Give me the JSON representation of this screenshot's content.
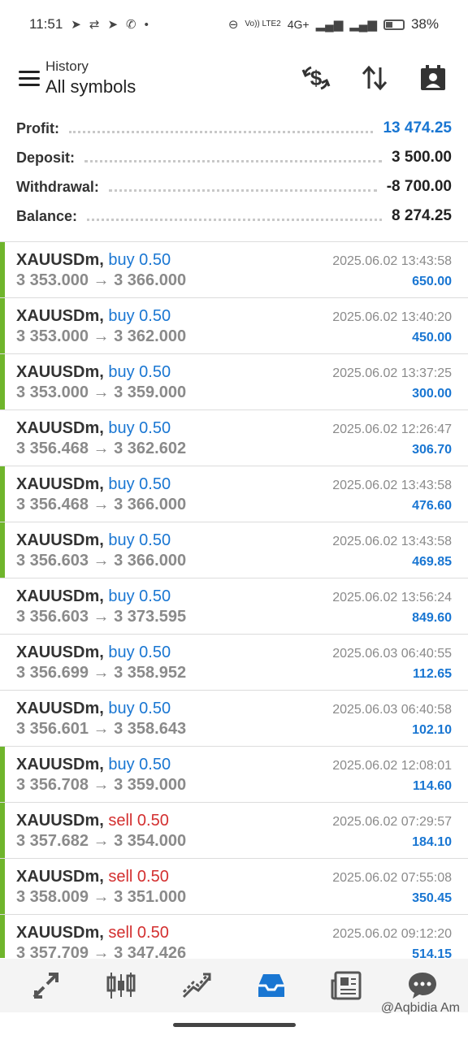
{
  "status_bar": {
    "time": "11:51",
    "network": "4G+",
    "volte": "Vo)) LTE2",
    "battery": "38%",
    "battery_level": 0.38
  },
  "header": {
    "subtitle": "History",
    "title": "All symbols",
    "icons": [
      "currency-exchange-icon",
      "sort-icon",
      "calendar-person-icon"
    ]
  },
  "summary": {
    "profit_label": "Profit:",
    "profit_value": "13 474.25",
    "deposit_label": "Deposit:",
    "deposit_value": "3 500.00",
    "withdrawal_label": "Withdrawal:",
    "withdrawal_value": "-8 700.00",
    "balance_label": "Balance:",
    "balance_value": "8 274.25"
  },
  "trades": [
    {
      "symbol": "XAUUSDm,",
      "direction": "buy 0.50",
      "type": "buy",
      "prices": "3 353.000 → 3 366.000",
      "time": "2025.06.02 13:43:58",
      "profit": "650.00",
      "marked": true
    },
    {
      "symbol": "XAUUSDm,",
      "direction": "buy 0.50",
      "type": "buy",
      "prices": "3 353.000 → 3 362.000",
      "time": "2025.06.02 13:40:20",
      "profit": "450.00",
      "marked": true
    },
    {
      "symbol": "XAUUSDm,",
      "direction": "buy 0.50",
      "type": "buy",
      "prices": "3 353.000 → 3 359.000",
      "time": "2025.06.02 13:37:25",
      "profit": "300.00",
      "marked": true
    },
    {
      "symbol": "XAUUSDm,",
      "direction": "buy 0.50",
      "type": "buy",
      "prices": "3 356.468 → 3 362.602",
      "time": "2025.06.02 12:26:47",
      "profit": "306.70",
      "marked": false
    },
    {
      "symbol": "XAUUSDm,",
      "direction": "buy 0.50",
      "type": "buy",
      "prices": "3 356.468 → 3 366.000",
      "time": "2025.06.02 13:43:58",
      "profit": "476.60",
      "marked": true
    },
    {
      "symbol": "XAUUSDm,",
      "direction": "buy 0.50",
      "type": "buy",
      "prices": "3 356.603 → 3 366.000",
      "time": "2025.06.02 13:43:58",
      "profit": "469.85",
      "marked": true
    },
    {
      "symbol": "XAUUSDm,",
      "direction": "buy 0.50",
      "type": "buy",
      "prices": "3 356.603 → 3 373.595",
      "time": "2025.06.02 13:56:24",
      "profit": "849.60",
      "marked": false
    },
    {
      "symbol": "XAUUSDm,",
      "direction": "buy 0.50",
      "type": "buy",
      "prices": "3 356.699 → 3 358.952",
      "time": "2025.06.03 06:40:55",
      "profit": "112.65",
      "marked": false
    },
    {
      "symbol": "XAUUSDm,",
      "direction": "buy 0.50",
      "type": "buy",
      "prices": "3 356.601 → 3 358.643",
      "time": "2025.06.03 06:40:58",
      "profit": "102.10",
      "marked": false
    },
    {
      "symbol": "XAUUSDm,",
      "direction": "buy 0.50",
      "type": "buy",
      "prices": "3 356.708 → 3 359.000",
      "time": "2025.06.02 12:08:01",
      "profit": "114.60",
      "marked": true
    },
    {
      "symbol": "XAUUSDm,",
      "direction": "sell 0.50",
      "type": "sell",
      "prices": "3 357.682 → 3 354.000",
      "time": "2025.06.02 07:29:57",
      "profit": "184.10",
      "marked": true
    },
    {
      "symbol": "XAUUSDm,",
      "direction": "sell 0.50",
      "type": "sell",
      "prices": "3 358.009 → 3 351.000",
      "time": "2025.06.02 07:55:08",
      "profit": "350.45",
      "marked": true
    },
    {
      "symbol": "XAUUSDm,",
      "direction": "sell 0.50",
      "type": "sell",
      "prices": "3 357.709 → 3 347.426",
      "time": "2025.06.02 09:12:20",
      "profit": "514.15",
      "marked": true
    }
  ],
  "bottom_nav": {
    "items": [
      "quotes-icon",
      "chart-icon",
      "trade-icon",
      "history-icon",
      "news-icon",
      "chat-icon"
    ],
    "active": "history-icon"
  },
  "watermark": "@Aqbidia Am",
  "colors": {
    "accent": "#1976d2",
    "sell": "#d32f2f",
    "marker": "#6fb52c"
  }
}
